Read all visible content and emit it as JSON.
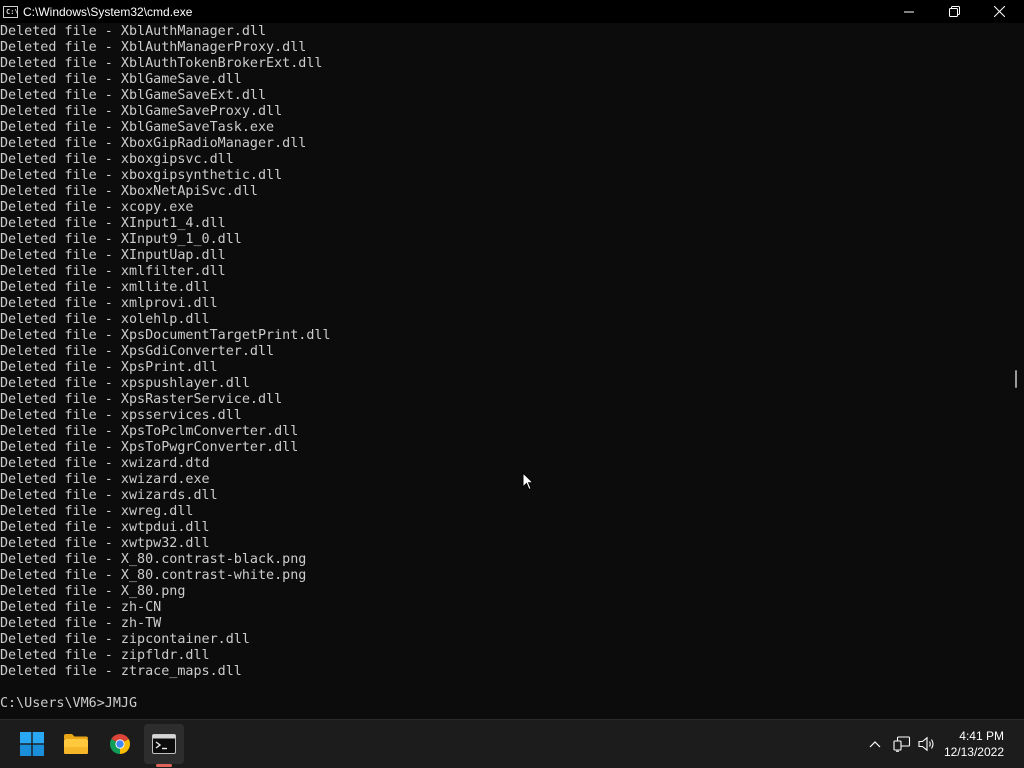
{
  "window": {
    "title": "C:\\Windows\\System32\\cmd.exe",
    "icon_text": "C:\\"
  },
  "console": {
    "lines": [
      "Deleted file - XblAuthManager.dll",
      "Deleted file - XblAuthManagerProxy.dll",
      "Deleted file - XblAuthTokenBrokerExt.dll",
      "Deleted file - XblGameSave.dll",
      "Deleted file - XblGameSaveExt.dll",
      "Deleted file - XblGameSaveProxy.dll",
      "Deleted file - XblGameSaveTask.exe",
      "Deleted file - XboxGipRadioManager.dll",
      "Deleted file - xboxgipsvc.dll",
      "Deleted file - xboxgipsynthetic.dll",
      "Deleted file - XboxNetApiSvc.dll",
      "Deleted file - xcopy.exe",
      "Deleted file - XInput1_4.dll",
      "Deleted file - XInput9_1_0.dll",
      "Deleted file - XInputUap.dll",
      "Deleted file - xmlfilter.dll",
      "Deleted file - xmllite.dll",
      "Deleted file - xmlprovi.dll",
      "Deleted file - xolehlp.dll",
      "Deleted file - XpsDocumentTargetPrint.dll",
      "Deleted file - XpsGdiConverter.dll",
      "Deleted file - XpsPrint.dll",
      "Deleted file - xpspushlayer.dll",
      "Deleted file - XpsRasterService.dll",
      "Deleted file - xpsservices.dll",
      "Deleted file - XpsToPclmConverter.dll",
      "Deleted file - XpsToPwgrConverter.dll",
      "Deleted file - xwizard.dtd",
      "Deleted file - xwizard.exe",
      "Deleted file - xwizards.dll",
      "Deleted file - xwreg.dll",
      "Deleted file - xwtpdui.dll",
      "Deleted file - xwtpw32.dll",
      "Deleted file - X_80.contrast-black.png",
      "Deleted file - X_80.contrast-white.png",
      "Deleted file - X_80.png",
      "Deleted file - zh-CN",
      "Deleted file - zh-TW",
      "Deleted file - zipcontainer.dll",
      "Deleted file - zipfldr.dll",
      "Deleted file - ztrace_maps.dll",
      ""
    ],
    "prompt": "C:\\Users\\VM6>JMJG"
  },
  "taskbar": {
    "apps": [
      {
        "name": "start",
        "icon": "windows-logo-icon"
      },
      {
        "name": "file-explorer",
        "icon": "folder-icon"
      },
      {
        "name": "chrome",
        "icon": "chrome-icon"
      },
      {
        "name": "command-prompt",
        "icon": "terminal-icon",
        "active": true
      }
    ],
    "tray_icons": [
      "chevron-up-icon",
      "network-icon",
      "speaker-icon"
    ]
  },
  "clock": {
    "time": "4:41 PM",
    "date": "12/13/2022"
  },
  "colors": {
    "console_background": "#0c0c0c",
    "console_text": "#cccccc",
    "taskbar_background": "#1c1c1c",
    "active_indicator": "#e0645c"
  }
}
